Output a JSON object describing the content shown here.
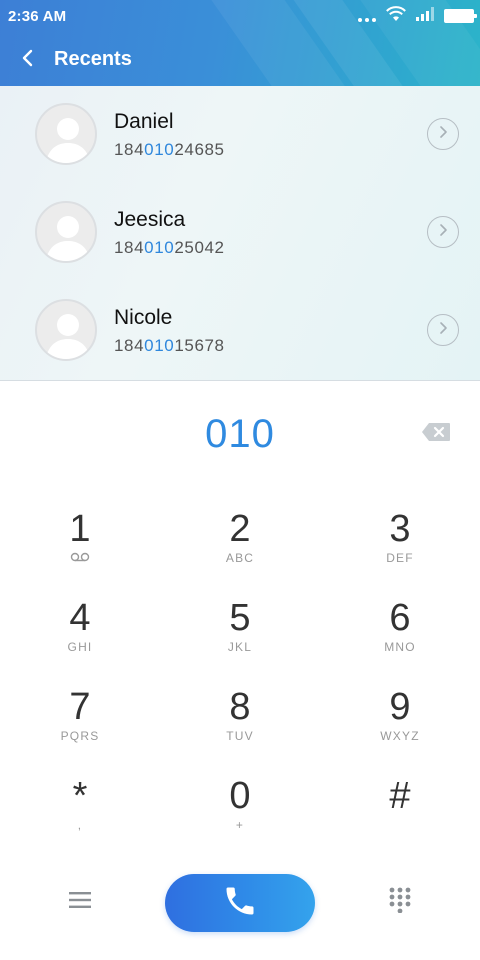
{
  "status_bar": {
    "time": "2:36 AM"
  },
  "header": {
    "title": "Recents"
  },
  "recents": [
    {
      "name": "Daniel",
      "number_prefix": "184",
      "number_match": "010",
      "number_suffix": "24685"
    },
    {
      "name": "Jeesica",
      "number_prefix": "184",
      "number_match": "010",
      "number_suffix": "25042"
    },
    {
      "name": "Nicole",
      "number_prefix": "184",
      "number_match": "010",
      "number_suffix": "15678"
    }
  ],
  "dialer": {
    "number": "010"
  },
  "keypad": {
    "keys": [
      {
        "digit": "1",
        "letters": ""
      },
      {
        "digit": "2",
        "letters": "ABC"
      },
      {
        "digit": "3",
        "letters": "DEF"
      },
      {
        "digit": "4",
        "letters": "GHI"
      },
      {
        "digit": "5",
        "letters": "JKL"
      },
      {
        "digit": "6",
        "letters": "MNO"
      },
      {
        "digit": "7",
        "letters": "PQRS"
      },
      {
        "digit": "8",
        "letters": "TUV"
      },
      {
        "digit": "9",
        "letters": "WXYZ"
      },
      {
        "digit": "*",
        "letters": ","
      },
      {
        "digit": "0",
        "letters": "+"
      },
      {
        "digit": "#",
        "letters": ""
      }
    ]
  },
  "colors": {
    "accent": "#2f8ae0",
    "header_start": "#3d7fd6",
    "header_end": "#2cb4c9",
    "call_button": "#2f7de6"
  },
  "icons": {
    "back": "chevron-left-icon",
    "detail": "chevron-right-circle-icon",
    "backspace": "backspace-icon",
    "voicemail": "voicemail-icon",
    "menu": "hamburger-menu-icon",
    "call": "phone-icon",
    "keypad_toggle": "dialpad-icon"
  }
}
